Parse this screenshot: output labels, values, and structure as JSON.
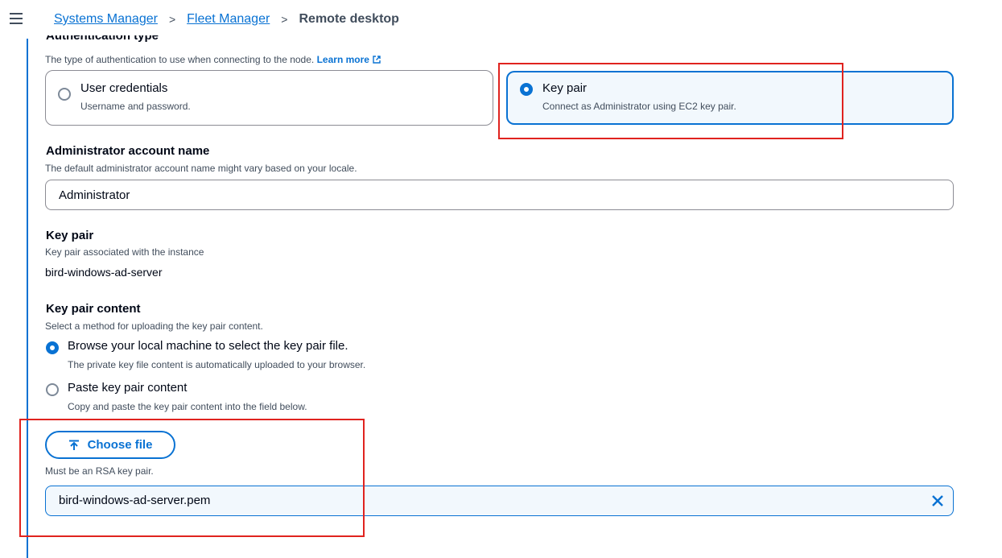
{
  "breadcrumb": {
    "items": [
      "Systems Manager",
      "Fleet Manager"
    ],
    "current": "Remote desktop",
    "separator": ">"
  },
  "auth": {
    "title": "Authentication type",
    "description": "The type of authentication to use when connecting to the node.",
    "learn_more": "Learn more",
    "options": [
      {
        "label": "User credentials",
        "description": "Username and password.",
        "selected": false
      },
      {
        "label": "Key pair",
        "description": "Connect as Administrator using EC2 key pair.",
        "selected": true
      }
    ]
  },
  "admin": {
    "title": "Administrator account name",
    "description": "The default administrator account name might vary based on your locale.",
    "value": "Administrator"
  },
  "keypair": {
    "title": "Key pair",
    "description": "Key pair associated with the instance",
    "value": "bird-windows-ad-server"
  },
  "keypair_content": {
    "title": "Key pair content",
    "description": "Select a method for uploading the key pair content.",
    "options": [
      {
        "label": "Browse your local machine to select the key pair file.",
        "description": "The private key file content is automatically uploaded to your browser.",
        "selected": true
      },
      {
        "label": "Paste key pair content",
        "description": "Copy and paste the key pair content into the field below.",
        "selected": false
      }
    ]
  },
  "upload": {
    "button_label": "Choose file",
    "constraint": "Must be an RSA key pair.",
    "file_name": "bird-windows-ad-server.pem"
  },
  "colors": {
    "accent": "#0972d3",
    "highlight": "#e0231f",
    "text": "#000716",
    "muted": "#414d5c"
  }
}
